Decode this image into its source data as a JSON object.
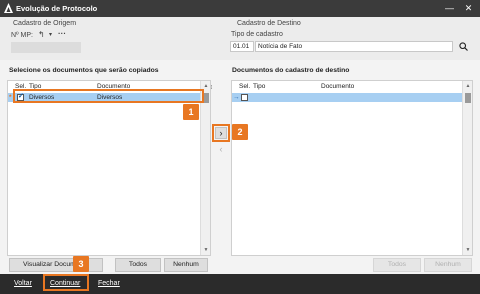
{
  "window": {
    "title": "Evolução de Protocolo",
    "minimize": "—",
    "close": "✕"
  },
  "origem": {
    "section_label": "Cadastro de Origem",
    "mp_label": "Nº MP:",
    "mp_value": ""
  },
  "destino": {
    "section_label": "Cadastro de Destino",
    "tipo_label": "Tipo de cadastro",
    "tipo_code": "01.01",
    "tipo_name": "Notícia de Fato"
  },
  "left_grid": {
    "title": "Selecione os documentos que serão copiados",
    "col_sel": "Sel.",
    "col_tipo": "Tipo",
    "col_documento": "Documento",
    "rows": [
      {
        "marker": "*",
        "checked": true,
        "tipo": "Diversos",
        "documento": "Diversos"
      }
    ]
  },
  "right_grid": {
    "title": "Documentos do cadastro de destino",
    "col_sel": "Sel.",
    "col_tipo": "Tipo",
    "col_documento": "Documento",
    "rows": [
      {
        "marker": "→",
        "checked": false,
        "tipo": "",
        "documento": ""
      }
    ]
  },
  "transfer": {
    "move_right": "›",
    "move_left": "‹"
  },
  "left_buttons": {
    "visualizar": "Visualizar Documento",
    "todos": "Todos",
    "nenhum": "Nenhum"
  },
  "right_buttons": {
    "todos": "Todos",
    "nenhum": "Nenhum"
  },
  "footer": {
    "voltar": "Voltar",
    "continuar": "Continuar",
    "fechar": "Fechar"
  },
  "badges": {
    "b1": "1",
    "b2": "2",
    "b3": "3"
  },
  "colors": {
    "accent": "#e87722",
    "selection": "#4a90d9",
    "row_highlight": "#a7cff2"
  }
}
